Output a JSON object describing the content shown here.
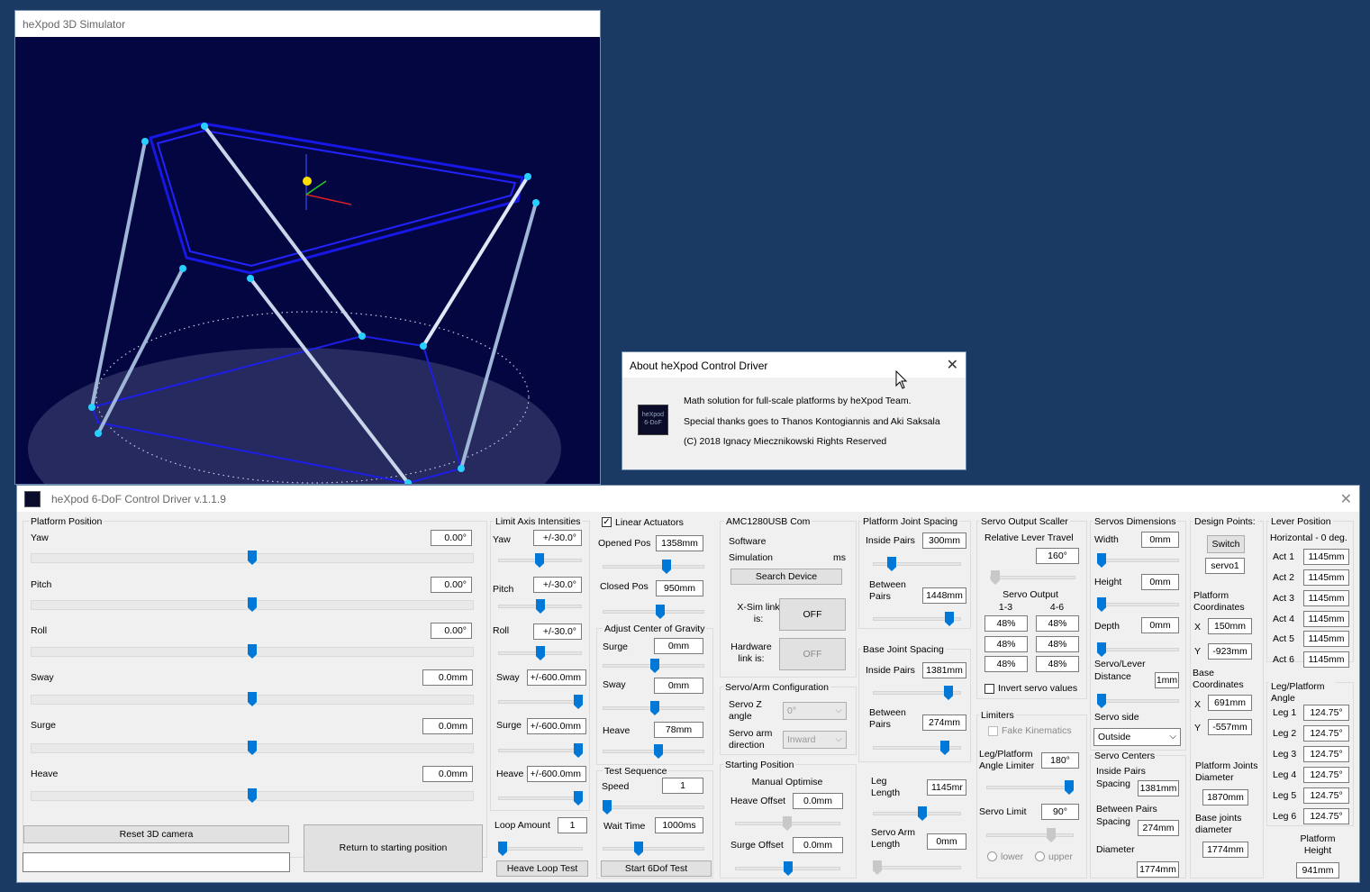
{
  "sim_window": {
    "title": "heXpod 3D Simulator"
  },
  "about_dialog": {
    "title": "About heXpod Control Driver",
    "logo_text": "heXpod 6-DoF",
    "line1": "Math solution for full-scale platforms by heXpod Team.",
    "line2": "Special thanks goes to Thanos Kontogiannis  and Aki Saksala",
    "line3": "(C) 2018 Ignacy Miecznikowski Rights Reserved"
  },
  "main_window": {
    "title": "heXpod 6-DoF Control Driver v.1.1.9",
    "platform_position": {
      "title": "Platform Position",
      "yaw": {
        "label": "Yaw",
        "value": "0.00°",
        "level": 0.5
      },
      "pitch": {
        "label": "Pitch",
        "value": "0.00°",
        "level": 0.5
      },
      "roll": {
        "label": "Roll",
        "value": "0.00°",
        "level": 0.5
      },
      "sway": {
        "label": "Sway",
        "value": "0.0mm",
        "level": 0.5
      },
      "surge": {
        "label": "Surge",
        "value": "0.0mm",
        "level": 0.5
      },
      "heave": {
        "label": "Heave",
        "value": "0.0mm",
        "level": 0.5
      }
    },
    "reset_camera": "Reset 3D camera",
    "return_start": "Return to starting position",
    "limit_axis": {
      "title": "Limit Axis Intensities",
      "yaw": {
        "label": "Yaw",
        "value": "+/-30.0°"
      },
      "pitch": {
        "label": "Pitch",
        "value": "+/-30.0°"
      },
      "roll": {
        "label": "Roll",
        "value": "+/-30.0°"
      },
      "sway": {
        "label": "Sway",
        "value": "+/-600.0mm"
      },
      "surge": {
        "label": "Surge",
        "value": "+/-600.0mm"
      },
      "heave": {
        "label": "Heave",
        "value": "+/-600.0mm"
      }
    },
    "loop": {
      "label": "Loop Amount",
      "value": "1",
      "button": "Heave  Loop Test"
    },
    "linear_actuators": {
      "checkbox": "Linear Actuators",
      "opened_label": "Opened Pos",
      "opened_value": "1358mm",
      "closed_label": "Closed Pos",
      "closed_value": "950mm"
    },
    "cog": {
      "title": "Adjust Center of Gravity",
      "surge_label": "Surge",
      "surge_value": "0mm",
      "sway_label": "Sway",
      "sway_value": "0mm",
      "heave_label": "Heave",
      "heave_value": "78mm"
    },
    "test_sequence": {
      "title": "Test Sequence",
      "speed_label": "Speed",
      "speed_value": "1",
      "wait_label": "Wait Time",
      "wait_value": "1000ms",
      "button": "Start 6Dof Test"
    },
    "com": {
      "title": "AMC1280USB Com",
      "software": "Software",
      "simulation": "Simulation",
      "ms": "ms",
      "search": "Search Device",
      "xsim_label": "X-Sim link is:",
      "xsim_value": "OFF",
      "hw_label": "Hardware link is:",
      "hw_value": "OFF"
    },
    "servo_arm": {
      "title": "Servo/Arm Configuration",
      "z_label": "Servo Z angle",
      "z_value": "0°",
      "dir_label": "Servo arm direction",
      "dir_value": "Inward"
    },
    "starting_position": {
      "title": "Starting Position",
      "manual": "Manual Optimise",
      "heave_label": "Heave Offset",
      "heave_value": "0.0mm",
      "surge_label": "Surge Offset",
      "surge_value": "0.0mm"
    },
    "platform_joint_spacing": {
      "title": "Platform Joint Spacing",
      "inside_label": "Inside Pairs",
      "inside_value": "300mm",
      "between_label": "Between Pairs",
      "between_value": "1448mm"
    },
    "base_joint_spacing": {
      "title": "Base Joint Spacing",
      "inside_label": "Inside Pairs",
      "inside_value": "1381mm",
      "between_label": "Between Pairs",
      "between_value": "274mm"
    },
    "leg_length": {
      "label": "Leg Length",
      "value": "1145mr"
    },
    "servo_arm_length": {
      "label": "Servo Arm Length",
      "value": "0mm"
    },
    "servo_output_scaler": {
      "title": "Servo Output Scaller",
      "relative": "Relative Lever Travel",
      "relative_value": "160°",
      "output_title": "Servo Output",
      "col1": "1-3",
      "col2": "4-6",
      "values": [
        "48%",
        "48%",
        "48%",
        "48%",
        "48%",
        "48%"
      ],
      "invert": "Invert servo values"
    },
    "limiters": {
      "title": "Limiters",
      "fake": "Fake Kinematics",
      "leg_label": "Leg/Platform Angle Limiter",
      "leg_value": "180°",
      "servo_label": "Servo Limit",
      "servo_value": "90°",
      "lower": "lower",
      "upper": "upper"
    },
    "servo_dimensions": {
      "title": "Servos Dimensions",
      "width_label": "Width",
      "width_value": "0mm",
      "height_label": "Height",
      "height_value": "0mm",
      "depth_label": "Depth",
      "depth_value": "0mm",
      "distance_label": "Servo/Lever Distance",
      "distance_value": "1mm",
      "side_label": "Servo side",
      "side_value": "Outside"
    },
    "servo_centers": {
      "title": "Servo Centers",
      "inside_label": "Inside Pairs Spacing",
      "inside_value": "1381mm",
      "between_label": "Between Pairs Spacing",
      "between_value": "274mm",
      "diameter_label": "Diameter",
      "diameter_value": "1774mm"
    },
    "design_points": {
      "title": "Design Points:",
      "switch": "Switch",
      "servo": "servo1",
      "platform_coords": "Platform Coordinates",
      "px": "150mm",
      "py": "-923mm",
      "base_coords": "Base Coordinates",
      "bx": "691mm",
      "by": "-557mm",
      "x": "X",
      "y": "Y",
      "pj_label": "Platform Joints Diameter",
      "pj_value": "1870mm",
      "bj_label": "Base joints diameter",
      "bj_value": "1774mm"
    },
    "lever_position": {
      "title": "Lever Position",
      "sub": "Horizontal - 0 deg.",
      "acts": [
        {
          "label": "Act 1",
          "value": "1145mm"
        },
        {
          "label": "Act 2",
          "value": "1145mm"
        },
        {
          "label": "Act 3",
          "value": "1145mm"
        },
        {
          "label": "Act 4",
          "value": "1145mm"
        },
        {
          "label": "Act 5",
          "value": "1145mm"
        },
        {
          "label": "Act 6",
          "value": "1145mm"
        }
      ],
      "angle_title": "Leg/Platform Angle",
      "legs": [
        {
          "label": "Leg 1",
          "value": "124.75°"
        },
        {
          "label": "Leg 2",
          "value": "124.75°"
        },
        {
          "label": "Leg 3",
          "value": "124.75°"
        },
        {
          "label": "Leg 4",
          "value": "124.75°"
        },
        {
          "label": "Leg 5",
          "value": "124.75°"
        },
        {
          "label": "Leg 6",
          "value": "124.75°"
        }
      ],
      "height_label": "Platform Height",
      "height_value": "941mm"
    }
  }
}
